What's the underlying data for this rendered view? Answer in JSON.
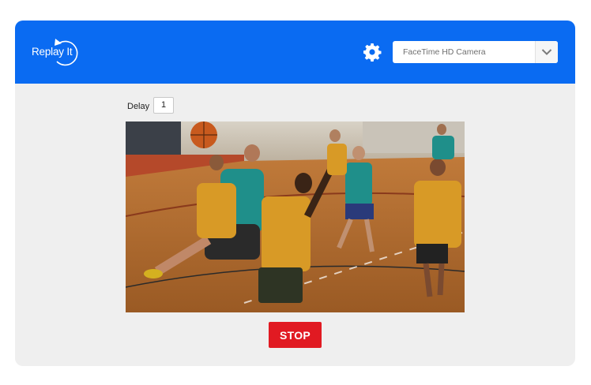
{
  "app": {
    "logo_text": "Replay It",
    "brand_color": "#0a6bf2"
  },
  "header": {
    "settings_icon": "gear-icon",
    "camera_select": {
      "selected": "FaceTime HD Camera",
      "arrow_icon": "chevron-down-icon"
    }
  },
  "controls": {
    "delay_label": "Delay",
    "delay_value": "1"
  },
  "video": {
    "description_icon": "camera-feed"
  },
  "actions": {
    "stop_label": "STOP",
    "stop_color": "#e11a22"
  }
}
